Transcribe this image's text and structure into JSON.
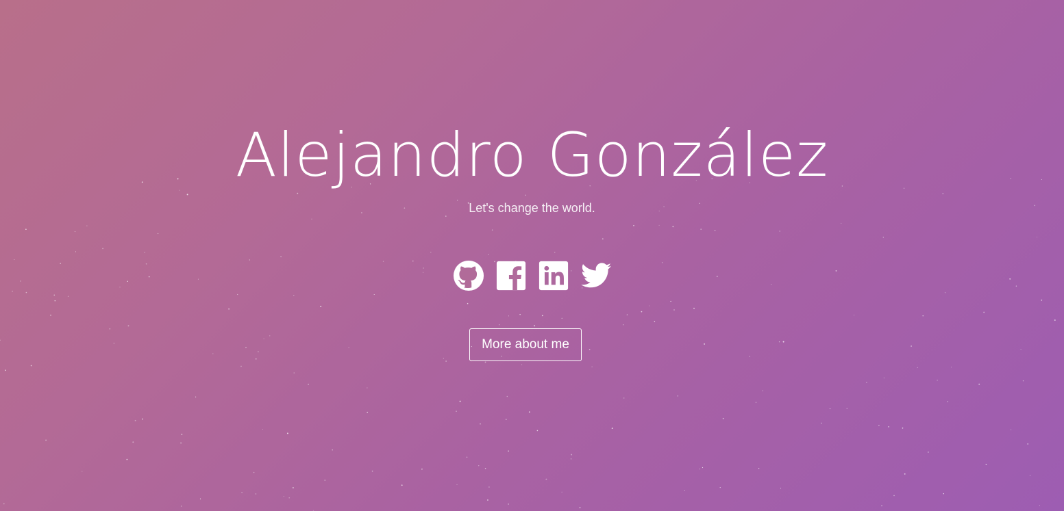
{
  "hero": {
    "name": "Alejandro González",
    "tagline": "Let's change the world."
  },
  "social": [
    {
      "icon": "github-icon"
    },
    {
      "icon": "facebook-icon"
    },
    {
      "icon": "linkedin-icon"
    },
    {
      "icon": "twitter-icon"
    }
  ],
  "cta": {
    "more_label": "More about me"
  },
  "colors": {
    "gradient_start": "#b86f8a",
    "gradient_end": "#9d5db2",
    "text": "#ffffff"
  }
}
